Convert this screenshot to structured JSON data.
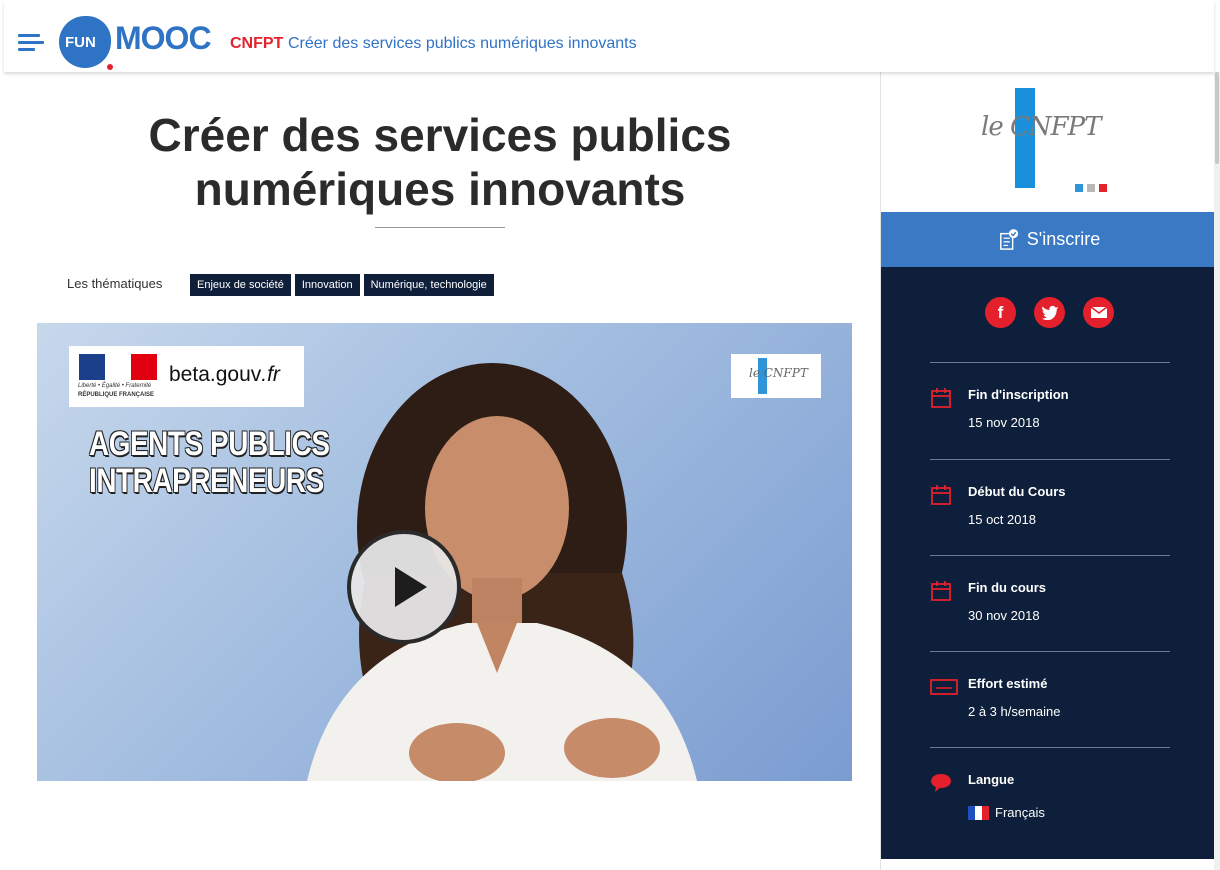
{
  "header": {
    "logo_prefix": "FUN",
    "logo_main": "MOOC",
    "org": "CNFPT",
    "course_title": "Créer des services publics numériques innovants"
  },
  "main": {
    "title": "Créer des services publics numériques innovants",
    "themes_label": "Les thématiques",
    "tags": [
      "Enjeux de société",
      "Innovation",
      "Numérique, technologie"
    ]
  },
  "video": {
    "gov_motto": "Liberté • Égalité • Fraternité",
    "gov_name": "RÉPUBLIQUE FRANÇAISE",
    "beta_site": "beta.gouv",
    "beta_tld": ".fr",
    "headline_line1": "AGENTS PUBLICS",
    "headline_line2": "INTRAPRENEURS",
    "cnfpt_logo_text": "le CNFPT"
  },
  "sidebar": {
    "logo_text": "le CNFPT",
    "enroll_label": "S'inscrire",
    "social": [
      "facebook-icon",
      "twitter-icon",
      "mail-icon"
    ],
    "info": [
      {
        "label": "Fin d'inscription",
        "value": "15 nov 2018",
        "icon": "calendar-icon"
      },
      {
        "label": "Début du Cours",
        "value": "15 oct 2018",
        "icon": "calendar-icon"
      },
      {
        "label": "Fin du cours",
        "value": "30 nov 2018",
        "icon": "calendar-icon"
      },
      {
        "label": "Effort estimé",
        "value": "2 à 3 h/semaine",
        "icon": "effort-icon"
      },
      {
        "label": "Langue",
        "value": "Français",
        "icon": "speech-bubble-icon"
      }
    ]
  },
  "colors": {
    "brand_blue": "#2f73c4",
    "accent_red": "#e2232e",
    "panel_navy": "#0d1f3a",
    "enroll_blue": "#3a7ac4"
  }
}
